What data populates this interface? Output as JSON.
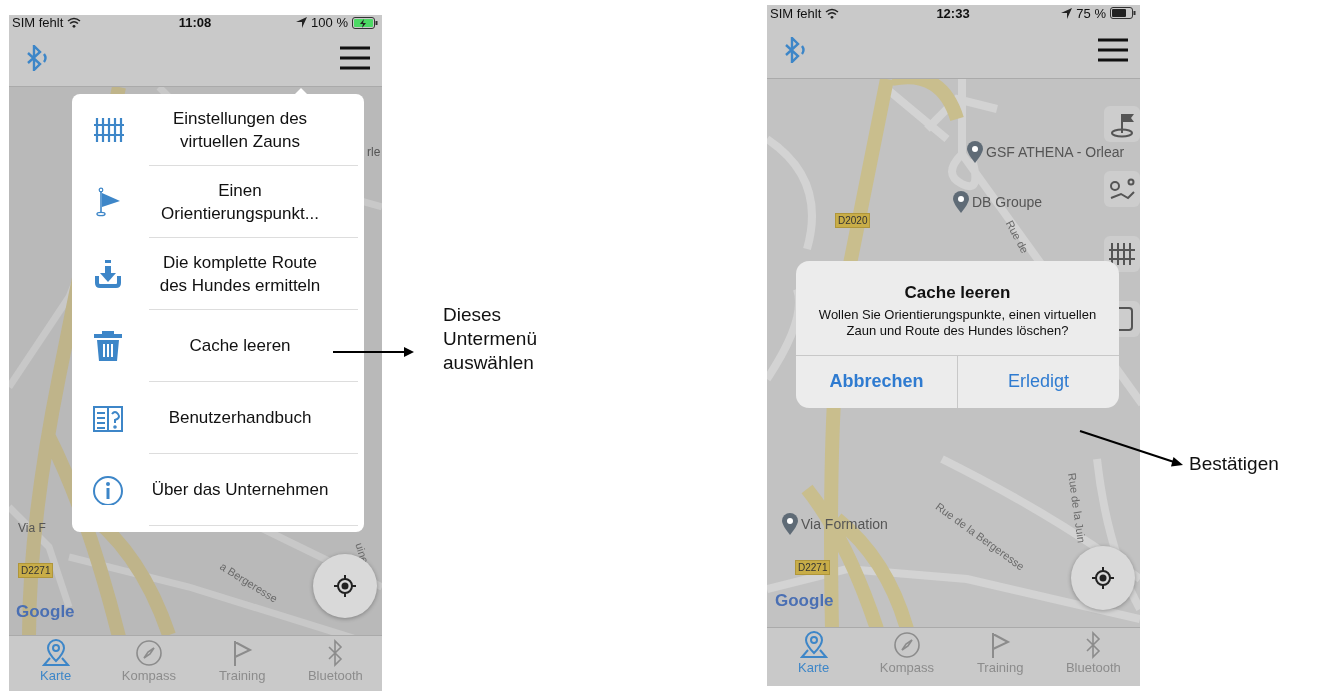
{
  "phones": [
    {
      "status_bar": {
        "carrier": "SIM fehlt",
        "time": "11:08",
        "battery": "100 %",
        "charging": true
      },
      "map_labels": [
        {
          "kind": "place",
          "text": "rle"
        },
        {
          "kind": "place",
          "text": "Via F"
        },
        {
          "kind": "shield",
          "text": "D2271"
        },
        {
          "kind": "street",
          "text": "a Bergeresse"
        },
        {
          "kind": "street",
          "text": "uine"
        },
        {
          "kind": "logo",
          "text": "Google"
        }
      ],
      "menu": {
        "items": [
          {
            "label": "Einstellungen des virtuellen Zauns"
          },
          {
            "label": "Einen Orientierungspunkt..."
          },
          {
            "label": "Die komplette Route des Hundes ermitteln"
          },
          {
            "label": "Cache leeren"
          },
          {
            "label": "Benutzerhandbuch"
          },
          {
            "label": "Über das Unternehmen"
          }
        ]
      },
      "tabs": [
        {
          "label": "Karte",
          "selected": true
        },
        {
          "label": "Kompass",
          "selected": false
        },
        {
          "label": "Training",
          "selected": false
        },
        {
          "label": "Bluetooth",
          "selected": false
        }
      ]
    },
    {
      "status_bar": {
        "carrier": "SIM fehlt",
        "time": "12:33",
        "battery": "75 %",
        "charging": false
      },
      "map_labels": [
        {
          "kind": "pin",
          "text": "GSF ATHENA - Orlear"
        },
        {
          "kind": "pin",
          "text": "DB Groupe"
        },
        {
          "kind": "shield",
          "text": "D2020"
        },
        {
          "kind": "street",
          "text": "Rue de"
        },
        {
          "kind": "pin",
          "text": "Via Formation"
        },
        {
          "kind": "street",
          "text": "Rue de la Bergeresse"
        },
        {
          "kind": "street",
          "text": "Rue de la Juin"
        },
        {
          "kind": "shield",
          "text": "D2271"
        },
        {
          "kind": "logo",
          "text": "Google"
        }
      ],
      "dialog": {
        "title": "Cache leeren",
        "message": "Wollen Sie Orientierungspunkte, einen virtuellen Zaun und Route des Hundes löschen?",
        "buttons": [
          {
            "label": "Abbrechen",
            "bold": true
          },
          {
            "label": "Erledigt",
            "bold": false
          }
        ]
      },
      "tabs": [
        {
          "label": "Karte",
          "selected": true
        },
        {
          "label": "Kompass",
          "selected": false
        },
        {
          "label": "Training",
          "selected": false
        },
        {
          "label": "Bluetooth",
          "selected": false
        }
      ]
    }
  ],
  "annotations": [
    {
      "text": "Dieses Untermenü auswählen"
    },
    {
      "text": "Bestätigen"
    }
  ]
}
